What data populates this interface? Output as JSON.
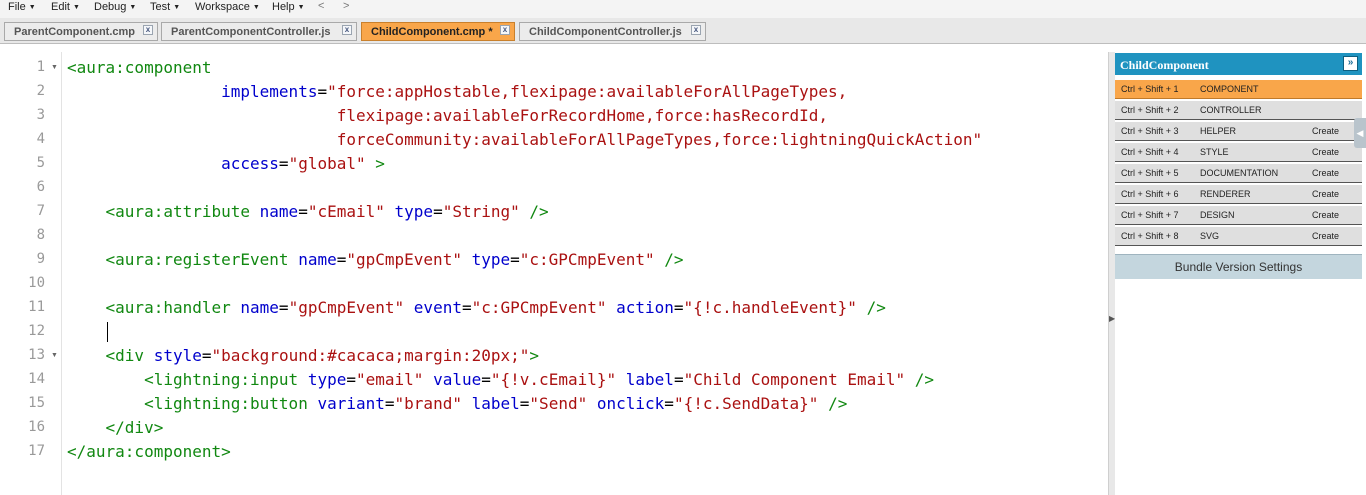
{
  "menu": [
    "File",
    "Edit",
    "Debug",
    "Test",
    "Workspace",
    "Help"
  ],
  "nav": {
    "back": "<",
    "forward": ">"
  },
  "tabs": [
    {
      "label": "ParentComponent.cmp",
      "active": false
    },
    {
      "label": "ParentComponentController.js",
      "active": false
    },
    {
      "label": "ChildComponent.cmp *",
      "active": true
    },
    {
      "label": "ChildComponentController.js",
      "active": false
    }
  ],
  "close_glyph": "x",
  "editor": {
    "line_numbers": [
      "1",
      "2",
      "3",
      "4",
      "5",
      "6",
      "7",
      "8",
      "9",
      "10",
      "11",
      "12",
      "13",
      "14",
      "15",
      "16",
      "17"
    ],
    "fold_marker": "▼",
    "lines": [
      [
        [
          "t",
          "<aura:component"
        ]
      ],
      [
        [
          "p",
          "                "
        ],
        [
          "a",
          "implements"
        ],
        [
          "p",
          "="
        ],
        [
          "s",
          "\"force:appHostable,flexipage:availableForAllPageTypes,"
        ]
      ],
      [
        [
          "s",
          "                            flexipage:availableForRecordHome,force:hasRecordId,"
        ]
      ],
      [
        [
          "s",
          "                            forceCommunity:availableForAllPageTypes,force:lightningQuickAction\""
        ]
      ],
      [
        [
          "p",
          "                "
        ],
        [
          "a",
          "access"
        ],
        [
          "p",
          "="
        ],
        [
          "s",
          "\"global\""
        ],
        [
          "t",
          " >"
        ]
      ],
      [],
      [
        [
          "t",
          "    <aura:attribute "
        ],
        [
          "a",
          "name"
        ],
        [
          "p",
          "="
        ],
        [
          "s",
          "\"cEmail\""
        ],
        [
          "p",
          " "
        ],
        [
          "a",
          "type"
        ],
        [
          "p",
          "="
        ],
        [
          "s",
          "\"String\""
        ],
        [
          "t",
          " />"
        ]
      ],
      [],
      [
        [
          "t",
          "    <aura:registerEvent "
        ],
        [
          "a",
          "name"
        ],
        [
          "p",
          "="
        ],
        [
          "s",
          "\"gpCmpEvent\""
        ],
        [
          "p",
          " "
        ],
        [
          "a",
          "type"
        ],
        [
          "p",
          "="
        ],
        [
          "s",
          "\"c:GPCmpEvent\""
        ],
        [
          "t",
          " />"
        ]
      ],
      [],
      [
        [
          "t",
          "    <aura:handler "
        ],
        [
          "a",
          "name"
        ],
        [
          "p",
          "="
        ],
        [
          "s",
          "\"gpCmpEvent\""
        ],
        [
          "p",
          " "
        ],
        [
          "a",
          "event"
        ],
        [
          "p",
          "="
        ],
        [
          "s",
          "\"c:GPCmpEvent\""
        ],
        [
          "p",
          " "
        ],
        [
          "a",
          "action"
        ],
        [
          "p",
          "="
        ],
        [
          "s",
          "\"{!c.handleEvent}\""
        ],
        [
          "t",
          " />"
        ]
      ],
      [],
      [
        [
          "t",
          "    <div "
        ],
        [
          "a",
          "style"
        ],
        [
          "p",
          "="
        ],
        [
          "s",
          "\"background:#cacaca;margin:20px;\""
        ],
        [
          "t",
          ">"
        ]
      ],
      [
        [
          "t",
          "        <lightning:input "
        ],
        [
          "a",
          "type"
        ],
        [
          "p",
          "="
        ],
        [
          "s",
          "\"email\""
        ],
        [
          "p",
          " "
        ],
        [
          "a",
          "value"
        ],
        [
          "p",
          "="
        ],
        [
          "s",
          "\"{!v.cEmail}\""
        ],
        [
          "p",
          " "
        ],
        [
          "a",
          "label"
        ],
        [
          "p",
          "="
        ],
        [
          "s",
          "\"Child Component Email\""
        ],
        [
          "t",
          " />"
        ]
      ],
      [
        [
          "t",
          "        <lightning:button "
        ],
        [
          "a",
          "variant"
        ],
        [
          "p",
          "="
        ],
        [
          "s",
          "\"brand\""
        ],
        [
          "p",
          " "
        ],
        [
          "a",
          "label"
        ],
        [
          "p",
          "="
        ],
        [
          "s",
          "\"Send\""
        ],
        [
          "p",
          " "
        ],
        [
          "a",
          "onclick"
        ],
        [
          "p",
          "="
        ],
        [
          "s",
          "\"{!c.SendData}\""
        ],
        [
          "t",
          " />"
        ]
      ],
      [
        [
          "t",
          "    </div>"
        ]
      ],
      [
        [
          "t",
          "</aura:component>"
        ]
      ]
    ]
  },
  "panel": {
    "title": "ChildComponent",
    "collapse_glyph": "»",
    "rows": [
      {
        "shortcut": "Ctrl + Shift + 1",
        "name": "COMPONENT",
        "action": "",
        "active": true
      },
      {
        "shortcut": "Ctrl + Shift + 2",
        "name": "CONTROLLER",
        "action": "",
        "active": false
      },
      {
        "shortcut": "Ctrl + Shift + 3",
        "name": "HELPER",
        "action": "Create",
        "active": false
      },
      {
        "shortcut": "Ctrl + Shift + 4",
        "name": "STYLE",
        "action": "Create",
        "active": false
      },
      {
        "shortcut": "Ctrl + Shift + 5",
        "name": "DOCUMENTATION",
        "action": "Create",
        "active": false
      },
      {
        "shortcut": "Ctrl + Shift + 6",
        "name": "RENDERER",
        "action": "Create",
        "active": false
      },
      {
        "shortcut": "Ctrl + Shift + 7",
        "name": "DESIGN",
        "action": "Create",
        "active": false
      },
      {
        "shortcut": "Ctrl + Shift + 8",
        "name": "SVG",
        "action": "Create",
        "active": false
      }
    ],
    "bundle_button": "Bundle Version Settings"
  },
  "colors": {
    "active_tab": "#f9a64a",
    "panel_header": "#1f93c0",
    "tag": "#118811",
    "attr": "#0000cc",
    "string": "#aa1111"
  }
}
